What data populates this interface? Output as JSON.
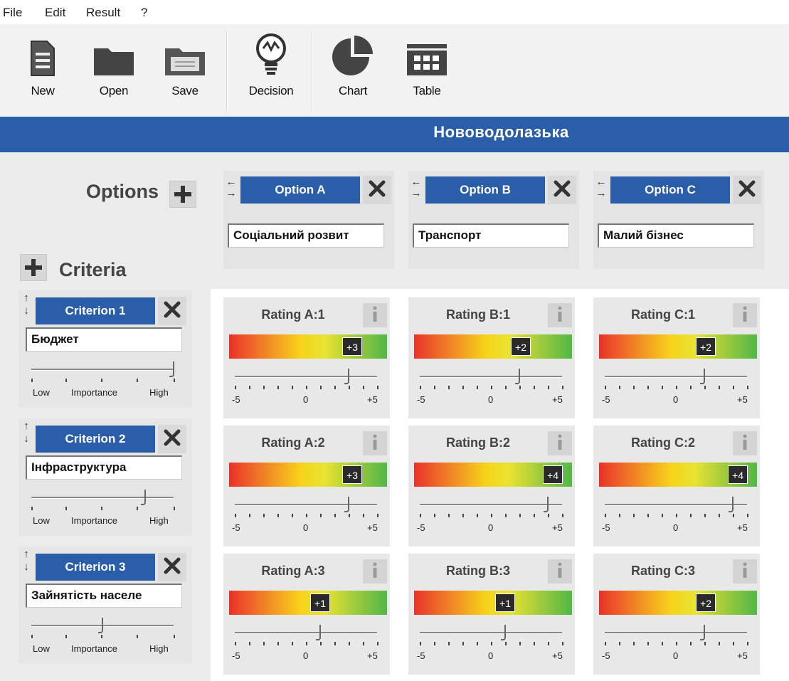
{
  "menu": [
    "File",
    "Edit",
    "Result",
    "?"
  ],
  "toolbar": {
    "new_label": "New",
    "open_label": "Open",
    "save_label": "Save",
    "decision_label": "Decision",
    "chart_label": "Chart",
    "table_label": "Table"
  },
  "banner_title": "Нововодолазька",
  "options_label": "Options",
  "criteria_label": "Criteria",
  "options": [
    {
      "label": "Option A",
      "value": "Соціальний розвит"
    },
    {
      "label": "Option B",
      "value": "Транспорт"
    },
    {
      "label": "Option C",
      "value": "Малий бізнес"
    }
  ],
  "criteria": [
    {
      "label": "Criterion 1",
      "value": "Бюджет",
      "importance": 1.0
    },
    {
      "label": "Criterion 2",
      "value": "Інфраструктура",
      "importance": 0.8
    },
    {
      "label": "Criterion 3",
      "value": "Зайнятість населе",
      "importance": 0.5
    }
  ],
  "importance_scale": {
    "low": "Low",
    "mid": "Importance",
    "high": "High"
  },
  "rating_scale": {
    "min": "-5",
    "mid": "0",
    "max": "+5"
  },
  "ratings": [
    [
      {
        "title": "Rating A:1",
        "label": "+3",
        "value": 3
      },
      {
        "title": "Rating B:1",
        "label": "+2",
        "value": 2
      },
      {
        "title": "Rating C:1",
        "label": "+2",
        "value": 2
      }
    ],
    [
      {
        "title": "Rating A:2",
        "label": "+3",
        "value": 3
      },
      {
        "title": "Rating B:2",
        "label": "+4",
        "value": 4
      },
      {
        "title": "Rating C:2",
        "label": "+4",
        "value": 4
      }
    ],
    [
      {
        "title": "Rating A:3",
        "label": "+1",
        "value": 1
      },
      {
        "title": "Rating B:3",
        "label": "+1",
        "value": 1
      },
      {
        "title": "Rating C:3",
        "label": "+2",
        "value": 2
      }
    ]
  ],
  "colors": {
    "accent": "#2b5ea8",
    "toolbar_bg": "#f2f2f2",
    "panel_bg": "#e8e8e8"
  }
}
